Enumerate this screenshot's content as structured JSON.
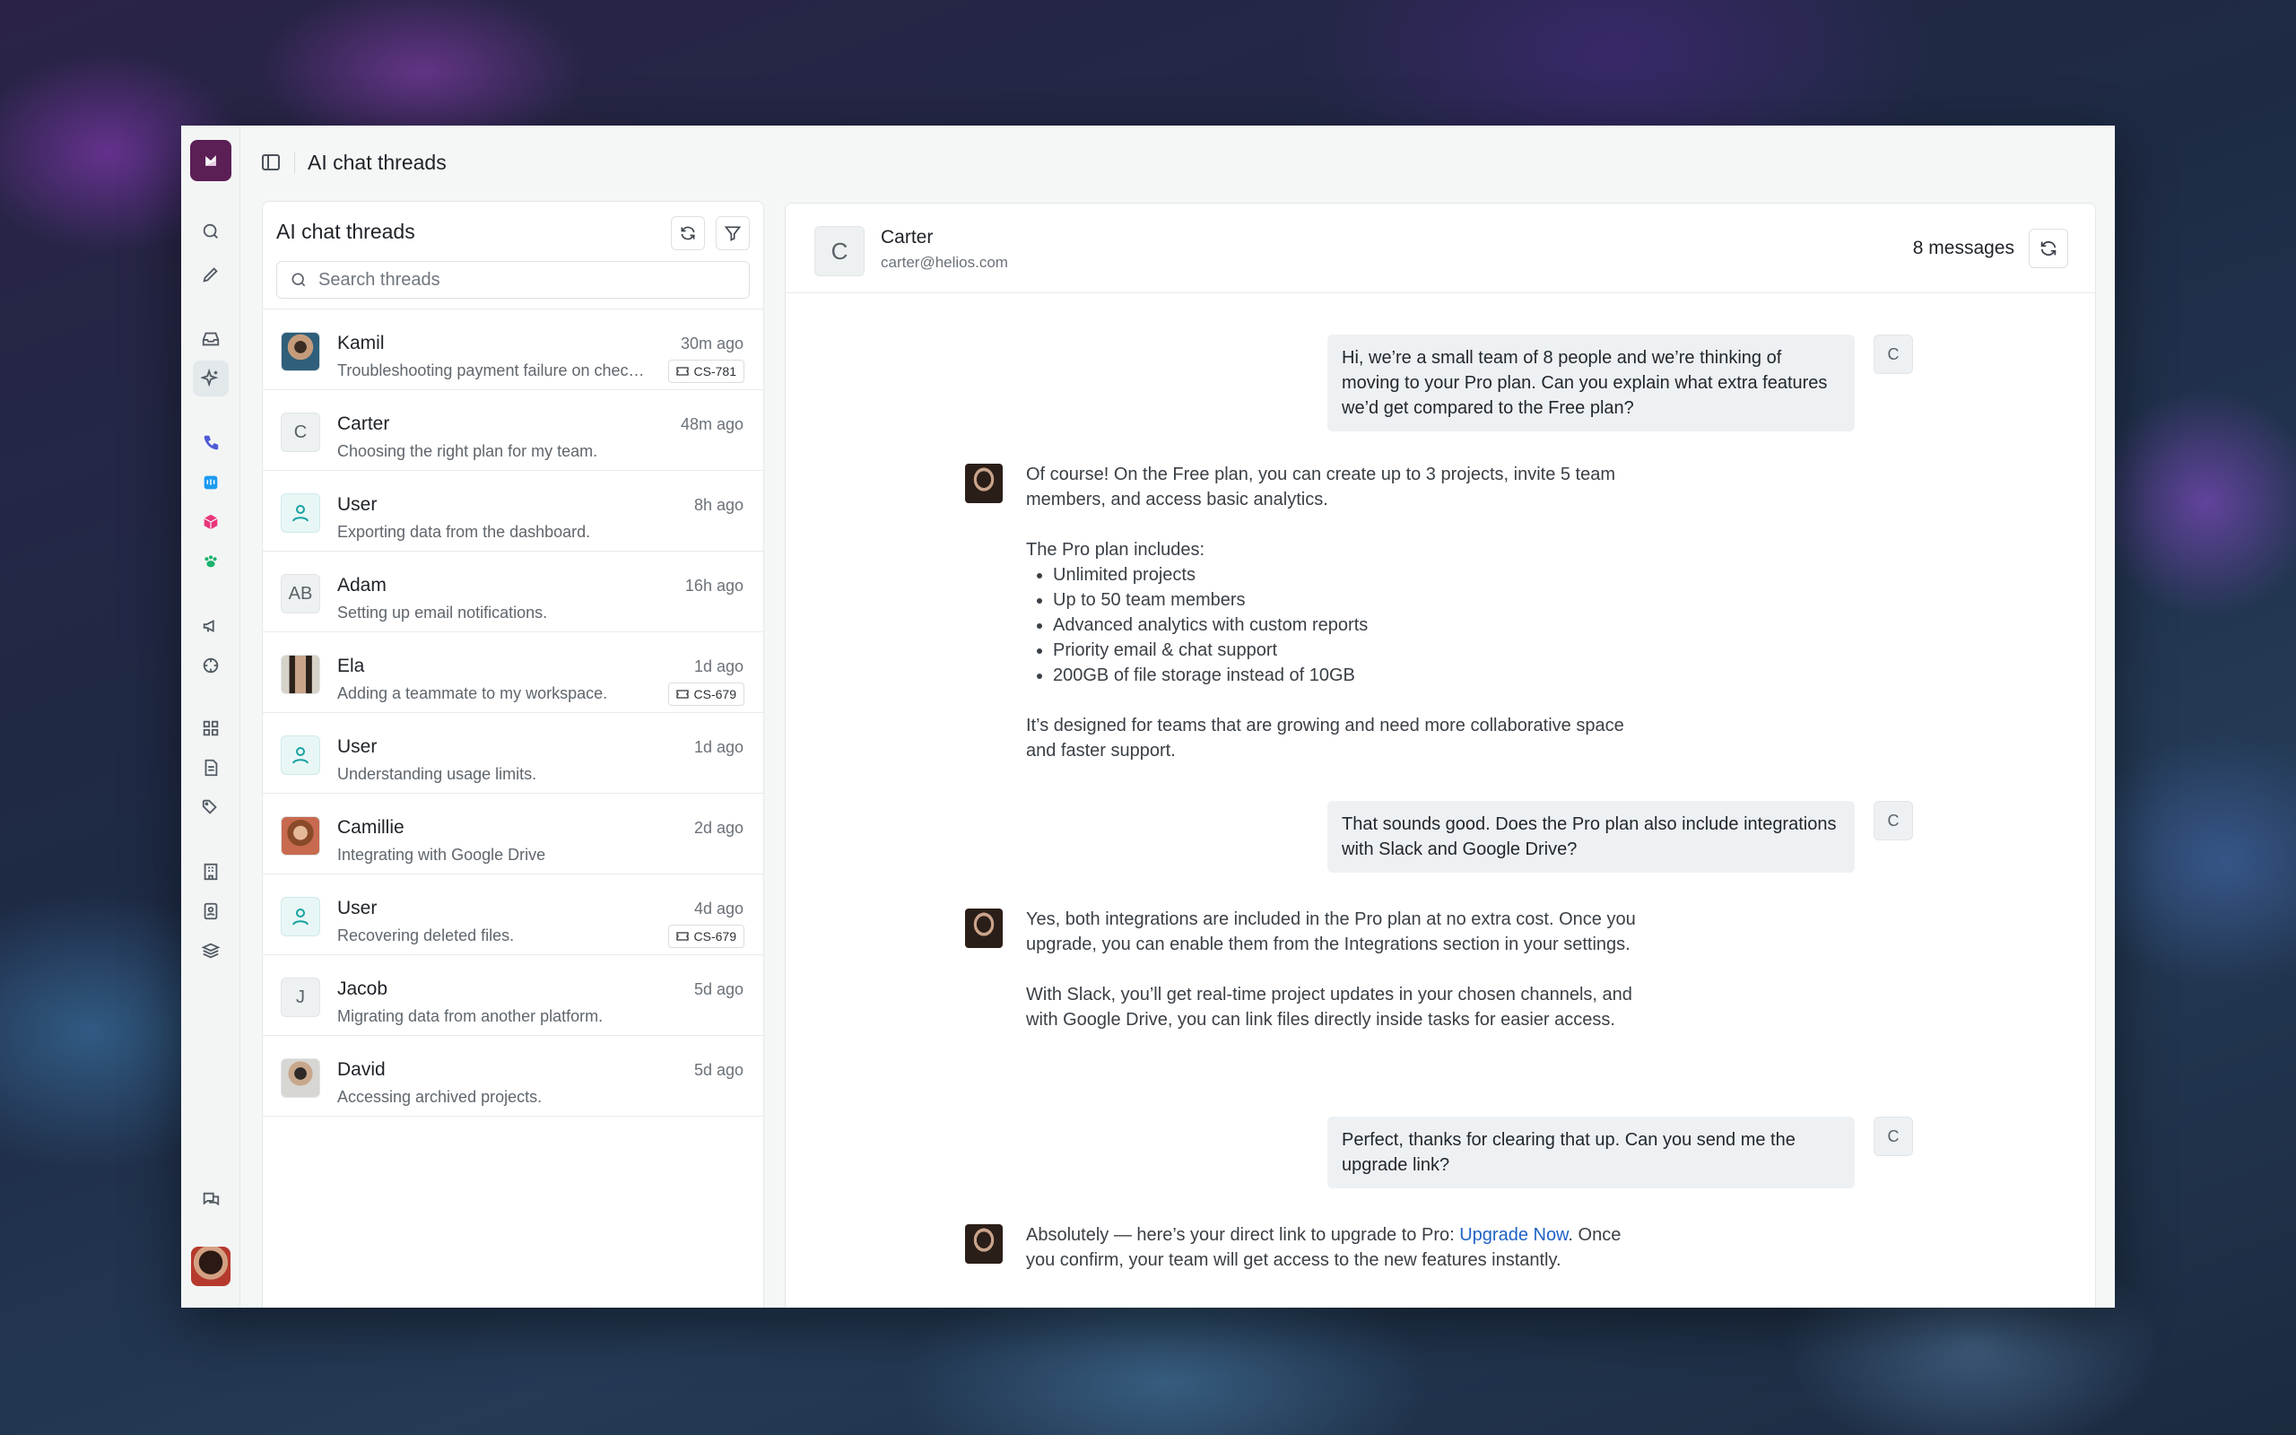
{
  "app": {
    "title": "AI chat threads"
  },
  "threads_panel": {
    "title": "AI chat threads",
    "search_placeholder": "Search threads",
    "items": [
      {
        "name": "Kamil",
        "snippet": "Troubleshooting payment failure on checkout.",
        "time": "30m ago",
        "tag": "CS-781",
        "avatar": "photo-kamil"
      },
      {
        "name": "Carter",
        "snippet": "Choosing the right plan for my team.",
        "time": "48m ago",
        "initials": "C"
      },
      {
        "name": "User",
        "snippet": "Exporting data from the dashboard.",
        "time": "8h ago",
        "avatar": "user"
      },
      {
        "name": "Adam",
        "snippet": "Setting up email notifications.",
        "time": "16h ago",
        "initials": "AB"
      },
      {
        "name": "Ela",
        "snippet": "Adding a teammate to my workspace.",
        "time": "1d ago",
        "tag": "CS-679",
        "avatar": "photo-ela"
      },
      {
        "name": "User",
        "snippet": "Understanding usage limits.",
        "time": "1d ago",
        "avatar": "user"
      },
      {
        "name": "Camillie",
        "snippet": "Integrating with Google Drive",
        "time": "2d ago",
        "avatar": "photo-camillie"
      },
      {
        "name": "User",
        "snippet": "Recovering deleted files.",
        "time": "4d ago",
        "tag": "CS-679",
        "avatar": "user"
      },
      {
        "name": "Jacob",
        "snippet": "Migrating data from another platform.",
        "time": "5d ago",
        "initials": "J"
      },
      {
        "name": "David",
        "snippet": "Accessing archived projects.",
        "time": "5d ago",
        "avatar": "photo-david"
      }
    ]
  },
  "conversation": {
    "contact_initial": "C",
    "contact_name": "Carter",
    "contact_email": "carter@helios.com",
    "message_count": "8 messages",
    "user_badge": "C",
    "messages": {
      "u1": "Hi, we’re a small team of 8 people and we’re thinking of moving to your Pro plan. Can you explain what extra features we’d get compared to the Free plan?",
      "b1_p1": "Of course! On the Free plan, you can create up to 3 projects, invite 5 team members, and access basic analytics.",
      "b1_p2": "The Pro plan includes:",
      "b1_list": [
        "Unlimited projects",
        "Up to 50 team members",
        "Advanced analytics with custom reports",
        "Priority email & chat support",
        "200GB of file storage instead of 10GB"
      ],
      "b1_p3": "It’s designed for teams that are growing and need more collaborative space and faster support.",
      "u2": "That sounds good. Does the Pro plan also include integrations with Slack and Google Drive?",
      "b2_p1": "Yes, both integrations are included in the Pro plan at no extra cost. Once you upgrade, you can enable them from the Integrations section in your settings.",
      "b2_p2": "With Slack, you’ll get real-time project updates in your chosen channels, and with Google Drive, you can link files directly inside tasks for easier access.",
      "u3": "Perfect, thanks for clearing that up. Can you send me the upgrade link?",
      "b3_before": "Absolutely — here’s your direct link to upgrade to Pro: ",
      "b3_link": "Upgrade Now",
      "b3_after": ". Once you confirm, your team will get access to the new features instantly."
    }
  },
  "colors": {
    "brand": "#5b1f56",
    "link": "#1f62c4",
    "user_accent": "#17a2a0"
  }
}
